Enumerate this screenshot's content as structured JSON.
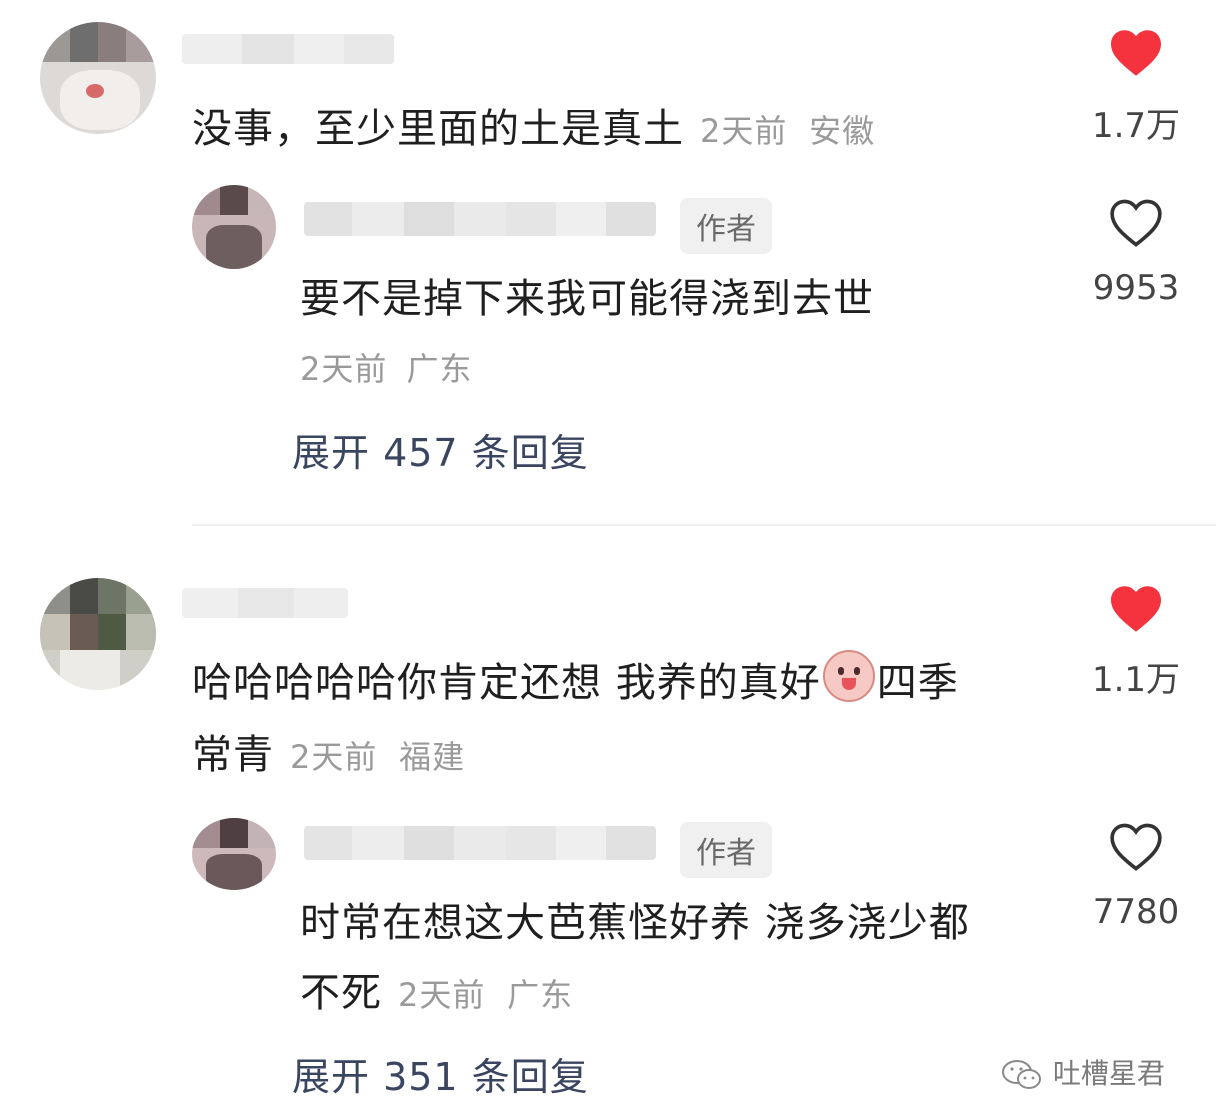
{
  "comments": [
    {
      "text": "没事，至少里面的土是真土",
      "time": "2天前",
      "location": "安徽",
      "likes": "1.7万",
      "liked": true,
      "reply": {
        "author_badge": "作者",
        "text": "要不是掉下来我可能得浇到去世",
        "time": "2天前",
        "location": "广东",
        "likes": "9953",
        "liked": false
      },
      "expand_label": "展开 457 条回复"
    },
    {
      "text_line1": "哈哈哈哈哈你肯定还想 我养的真好",
      "text_line1_tail": "四季",
      "text_line2": "常青",
      "time": "2天前",
      "location": "福建",
      "likes": "1.1万",
      "liked": true,
      "reply": {
        "author_badge": "作者",
        "text_line1": "时常在想这大芭蕉怪好养 浇多浇少都",
        "text_line2": "不死",
        "time": "2天前",
        "location": "广东",
        "likes": "7780",
        "liked": false
      },
      "expand_label": "展开 351 条回复"
    }
  ],
  "watermark": "吐槽星君",
  "colors": {
    "heart_liked": "#f5333f",
    "heart_outline": "#333333",
    "expand_text": "#3a4560",
    "meta_text": "#9a9a9a"
  },
  "icons": {
    "liked": "heart-filled-icon",
    "unliked": "heart-outline-icon",
    "emoji": "blushing-face-emoji",
    "watermark": "wechat-icon"
  }
}
